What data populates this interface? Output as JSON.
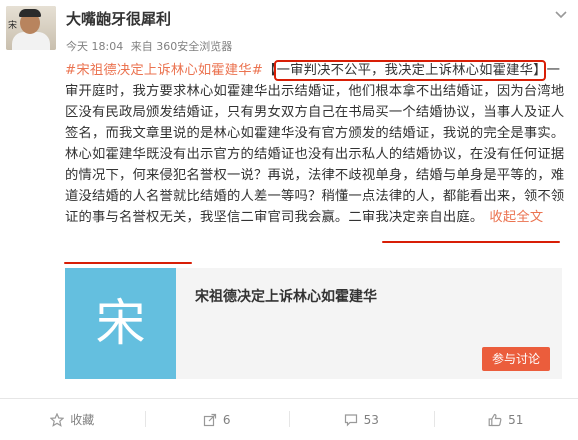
{
  "post": {
    "username": "大嘴龅牙很犀利",
    "time": "今天 18:04",
    "source": "来自 360安全浏览器",
    "hashtag": "#宋祖德决定上诉林心如霍建华#",
    "bracket": "【一审判决不公平，我决定上诉林心如霍建华】",
    "paragraph": "一审开庭时，我方要求林心如霍建华出示结婚证，他们根本拿不出结婚证，因为台湾地区没有民政局颁发结婚证，只有男女双方自己在书局买一个结婚协议，当事人及证人签名，而我文章里说的是林心如霍建华没有官方颁发的结婚证，我说的完全是事实。林心如霍建华既没有出示官方的结婚证也没有出示私人的结婚协议，在没有任何证据的情况下，何来侵犯名誉权一说？再说，法律不歧视单身，结婚与单身是平等的，难道没结婚的人名誉就比结婚的人差一等吗？稍懂一点法律的人，都能看出来，领不领证的事与名誉权无关，",
    "tail": "我坚信二审官司我会赢。二审我决定亲自出庭。",
    "collapse": "收起全文",
    "avatar_tag": "宋"
  },
  "card": {
    "thumb_char": "宋",
    "title": "宋祖德决定上诉林心如霍建华",
    "join_button": "参与讨论"
  },
  "actions": [
    {
      "icon": "star-icon",
      "label": "收藏"
    },
    {
      "icon": "share-icon",
      "label": "6"
    },
    {
      "icon": "comment-icon",
      "label": "53"
    },
    {
      "icon": "thumbs-up-icon",
      "label": "51"
    }
  ],
  "colors": {
    "accent": "#eb7350",
    "highlight": "#d81e06",
    "card_thumb": "#64bfdf",
    "join_button": "#eb5d3c"
  }
}
